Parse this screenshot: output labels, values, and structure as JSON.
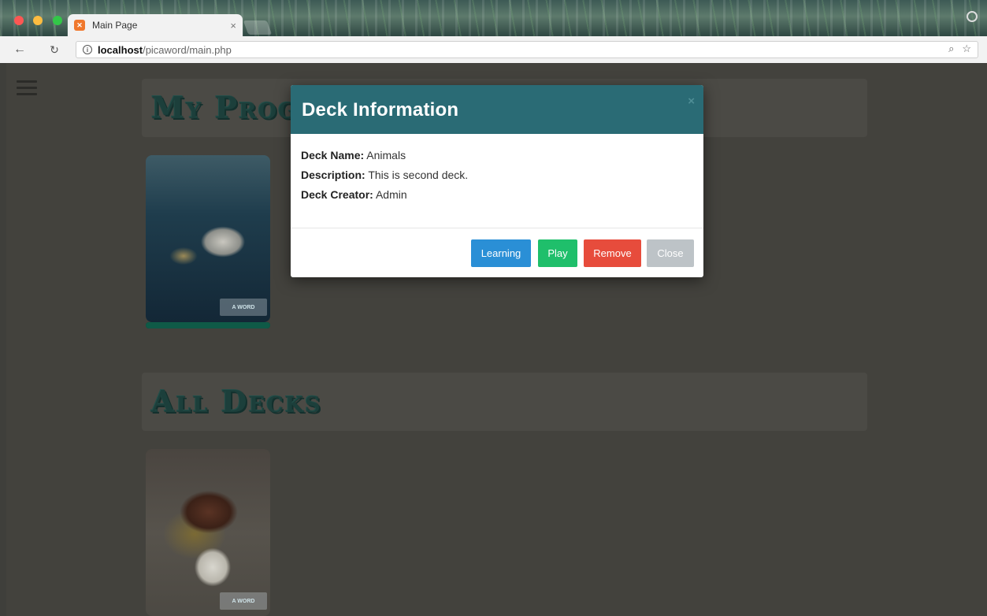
{
  "browser": {
    "tab_title": "Main Page",
    "tab_close": "×",
    "url_host": "localhost",
    "url_path": "/picaword/main.php",
    "traffic_lights": [
      "#fc5753",
      "#fdbc40",
      "#33c748"
    ]
  },
  "page": {
    "sections": [
      {
        "title": "My Progress"
      },
      {
        "title": "All Decks"
      }
    ],
    "my_progress_card": {
      "badge": "A WORD",
      "progress_fraction": 1.0
    },
    "all_decks_card": {
      "badge": "A WORD"
    }
  },
  "modal": {
    "title": "Deck Information",
    "close_glyph": "×",
    "fields": [
      {
        "label": "Deck Name:",
        "value": "Animals"
      },
      {
        "label": "Description:",
        "value": "This is second deck."
      },
      {
        "label": "Deck Creator:",
        "value": "Admin"
      }
    ],
    "buttons": {
      "learning": "Learning",
      "play": "Play",
      "remove": "Remove",
      "close": "Close"
    }
  },
  "colors": {
    "modal_header": "#2a6b75",
    "learning": "#2a8fd6",
    "play": "#1fbf6b",
    "remove": "#e74c3c",
    "close": "#bdc3c7"
  }
}
